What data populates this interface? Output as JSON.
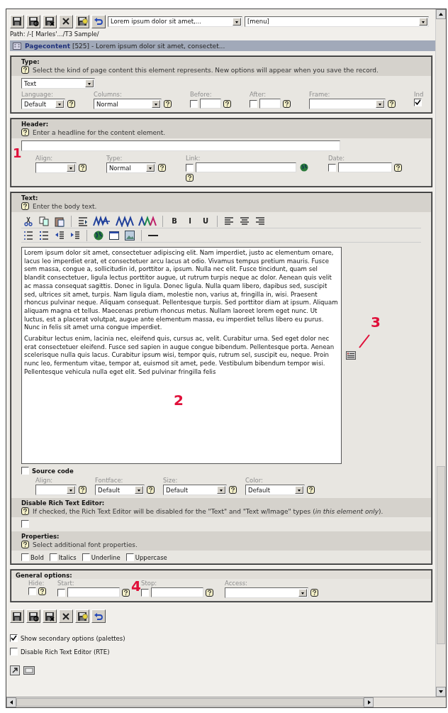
{
  "toolbar": {
    "buttons": [
      {
        "kind": "save"
      },
      {
        "kind": "save-view"
      },
      {
        "kind": "save-close"
      },
      {
        "kind": "close"
      },
      {
        "kind": "save-new"
      },
      {
        "kind": "undo"
      }
    ],
    "record_select": {
      "value": "Lorem ipsum dolor sit amet,..."
    },
    "menu_select": {
      "value": "[menu]"
    }
  },
  "path": "Path: /-[ Marles'.../T3 Sample/",
  "record_header": "**Pagecontent** [525] - Lorem ipsum dolor sit amet, consectet...",
  "boxes": [
    {
      "fields": [
        {
          "title": "Type:",
          "help": "Select the kind of page content this element represents. New options will appear when you save the record.",
          "control": {
            "kind": "select",
            "value": "Text"
          },
          "palette": [
            {
              "label": "Language:",
              "kind": "select",
              "value": "Default",
              "help": true
            },
            {
              "label": "Columns:",
              "kind": "select",
              "value": "Normal",
              "help": true
            },
            {
              "label": "Before:",
              "kind": "check-input",
              "checked": false,
              "help": true
            },
            {
              "label": "After:",
              "kind": "check-input",
              "checked": false,
              "help": true
            },
            {
              "label": "Frame:",
              "kind": "select",
              "help": true
            },
            {
              "label": "Ind",
              "kind": "check",
              "checked": true,
              "help": false
            }
          ]
        }
      ]
    },
    {
      "fields": [
        {
          "title": "Header:",
          "help": "Enter a headline for the content element.",
          "control": {
            "kind": "input"
          },
          "palette": [
            {
              "label": "Align:",
              "kind": "select",
              "help": true
            },
            {
              "label": "Type:",
              "kind": "select",
              "value": "Normal",
              "help": true
            },
            {
              "label": "Link:",
              "kind": "link",
              "checked": false,
              "help": true
            },
            {
              "label": "Date:",
              "kind": "check-input",
              "checked": false,
              "help": true
            }
          ]
        }
      ]
    },
    {
      "fields": [
        {
          "title": "Text:",
          "help": "Enter the body text.",
          "control": {
            "kind": "rte",
            "toolbar": [
              [
                [
                  {
                    "kind": "cut"
                  },
                  {
                    "kind": "copy"
                  },
                  {
                    "kind": "paste"
                  }
                ],
                [
                  {
                    "kind": "paragraph"
                  },
                  {
                    "kind": "style-wave"
                  },
                  {
                    "kind": "wave-blue"
                  },
                  {
                    "kind": "wave-color"
                  }
                ],
                [
                  {
                    "kind": "text",
                    "label": "B"
                  },
                  {
                    "kind": "text",
                    "label": "I"
                  },
                  {
                    "kind": "text",
                    "label": "U"
                  }
                ],
                [
                  {
                    "kind": "align-left"
                  },
                  {
                    "kind": "align-center"
                  },
                  {
                    "kind": "align-right"
                  }
                ]
              ],
              [
                [
                  {
                    "kind": "ordered-list"
                  },
                  {
                    "kind": "bullet-list"
                  },
                  {
                    "kind": "outdent"
                  },
                  {
                    "kind": "indent"
                  }
                ],
                [
                  {
                    "kind": "globe"
                  },
                  {
                    "kind": "window"
                  },
                  {
                    "kind": "image"
                  }
                ],
                [
                  {
                    "kind": "rule"
                  }
                ]
              ]
            ],
            "paragraphs": [
              "Lorem ipsum dolor sit amet, consectetuer adipiscing elit. Nam imperdiet, justo ac elementum ornare, lacus leo imperdiet erat, et consectetuer arcu lacus at odio. Vivamus tempus pretium mauris. Fusce sem massa, congue a, sollicitudin id, porttitor a, ipsum. Nulla nec elit. Fusce tincidunt, quam sel blandit consectetuer, ligula lectus porttitor augue, ut rutrum turpis neque ac dolor. Aenean quis velit ac massa consequat sagittis. Donec in ligula. Donec ligula. Nulla quam libero, dapibus sed, suscipit sed, ultrices sit amet, turpis. Nam ligula diam, molestie non, varius at, fringilla in, wisi. Praesent rhoncus pulvinar neque. Aliquam consequat. Pellentesque turpis. Sed porttitor diam at ipsum. Aliquam aliquam magna et tellus. Maecenas pretium rhoncus metus. Nullam laoreet lorem eget nunc. Ut luctus, est a placerat volutpat, augue ante elementum massa, eu imperdiet tellus libero eu purus. Nunc in felis sit amet urna congue imperdiet.",
              "Curabitur lectus enim, lacinia nec, eleifend quis, cursus ac, velit. Curabitur urna. Sed eget dolor nec erat consectetuer eleifend. Fusce sed sapien in augue congue bibendum. Pellentesque porta. Aenean scelerisque nulla quis lacus. Curabitur ipsum wisi, tempor quis, rutrum sel, suscipit eu, neque. Proin nunc leo, fermentum vitae, tempor at, euismod sit amet, pede. Vestibulum bibendum tempor wisi. Pellentesque vehicula nulla eget elit. Sed pulvinar fringilla felis"
            ],
            "source_code": {
              "label": "Source code",
              "checked": false
            }
          },
          "palette": [
            {
              "label": "Align:",
              "kind": "select",
              "help": true
            },
            {
              "label": "Fontface:",
              "kind": "select",
              "value": "Default",
              "help": true
            },
            {
              "label": "Size:",
              "kind": "select",
              "value": "Default",
              "help": true
            },
            {
              "label": "Color:",
              "kind": "select",
              "value": "Default",
              "help": true
            }
          ]
        },
        {
          "title": "Disable Rich Text Editor:",
          "help": "If checked, the Rich Text Editor will be disabled for the \"Text\" and \"Text w/Image\" types (*in this element only*).",
          "control": {
            "kind": "checkbox",
            "checked": false
          }
        },
        {
          "title": "Properties:",
          "help": "Select additional font properties.",
          "control": {
            "kind": "checkgroup",
            "options": [
              {
                "label": "Bold",
                "checked": false
              },
              {
                "label": "Italics",
                "checked": false
              },
              {
                "label": "Underline",
                "checked": false
              },
              {
                "label": "Uppercase",
                "checked": false
              }
            ]
          }
        }
      ]
    },
    {
      "fields": [
        {
          "title": "General options:",
          "palette": [
            {
              "label": "Hide:",
              "kind": "check",
              "checked": false,
              "help": true
            },
            {
              "label": "Start:",
              "kind": "check-input",
              "checked": false,
              "help": true
            },
            {
              "label": "Stop:",
              "kind": "check-input",
              "checked": false,
              "help": true
            },
            {
              "label": "Access:",
              "kind": "select",
              "help": true
            }
          ]
        }
      ]
    }
  ],
  "bottom_buttons": [
    {
      "kind": "save"
    },
    {
      "kind": "save-view"
    },
    {
      "kind": "save-close"
    },
    {
      "kind": "close"
    },
    {
      "kind": "save-new"
    },
    {
      "kind": "undo"
    }
  ],
  "options": [
    {
      "label": "Show secondary options (palettes)",
      "checked": true
    },
    {
      "label": "Disable Rich Text Editor (RTE)",
      "checked": false
    }
  ],
  "footer_icons": [
    {
      "kind": "shortcut"
    },
    {
      "kind": "window"
    }
  ],
  "annotations": [
    {
      "label": "1",
      "leader": false
    },
    {
      "label": "2",
      "leader": false
    },
    {
      "label": "3",
      "leader": true
    },
    {
      "label": "4",
      "leader": false
    }
  ]
}
